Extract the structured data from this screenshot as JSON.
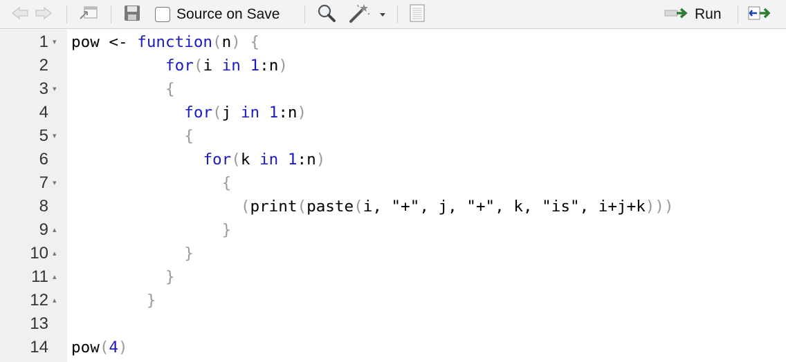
{
  "toolbar": {
    "source_on_save_label": "Source on Save",
    "source_on_save_checked": false,
    "run_label": "Run",
    "icons": [
      "back-arrow-icon",
      "forward-arrow-icon",
      "show-in-window-icon",
      "save-icon",
      "search-icon",
      "code-tools-wand-icon",
      "dropdown-caret-icon",
      "compile-report-icon",
      "run-arrow-icon",
      "rerun-icon"
    ]
  },
  "editor": {
    "language": "R",
    "line_numbers": [
      "1",
      "2",
      "3",
      "4",
      "5",
      "6",
      "7",
      "8",
      "9",
      "10",
      "11",
      "12",
      "13",
      "14"
    ],
    "fold_markers": [
      "down",
      "",
      "down",
      "",
      "down",
      "",
      "down",
      "",
      "up",
      "up",
      "up",
      "up",
      "",
      ""
    ],
    "lines": [
      "pow <- function(n) {",
      "          for(i in 1:n)",
      "          {",
      "            for(j in 1:n)",
      "            {",
      "              for(k in 1:n)",
      "                {",
      "                  (print(paste(i, \"+\", j, \"+\", k, \"is\", i+j+k)))",
      "                }",
      "            }",
      "          }",
      "        }",
      "",
      "pow(4)"
    ]
  },
  "colors": {
    "keyword": "#1b1bc0",
    "number": "#1b1bc0",
    "punctuation": "#9a9a9a",
    "text": "#000000",
    "gutter_bg": "#f0f0f0",
    "toolbar_bg": "#f3f3f3"
  }
}
